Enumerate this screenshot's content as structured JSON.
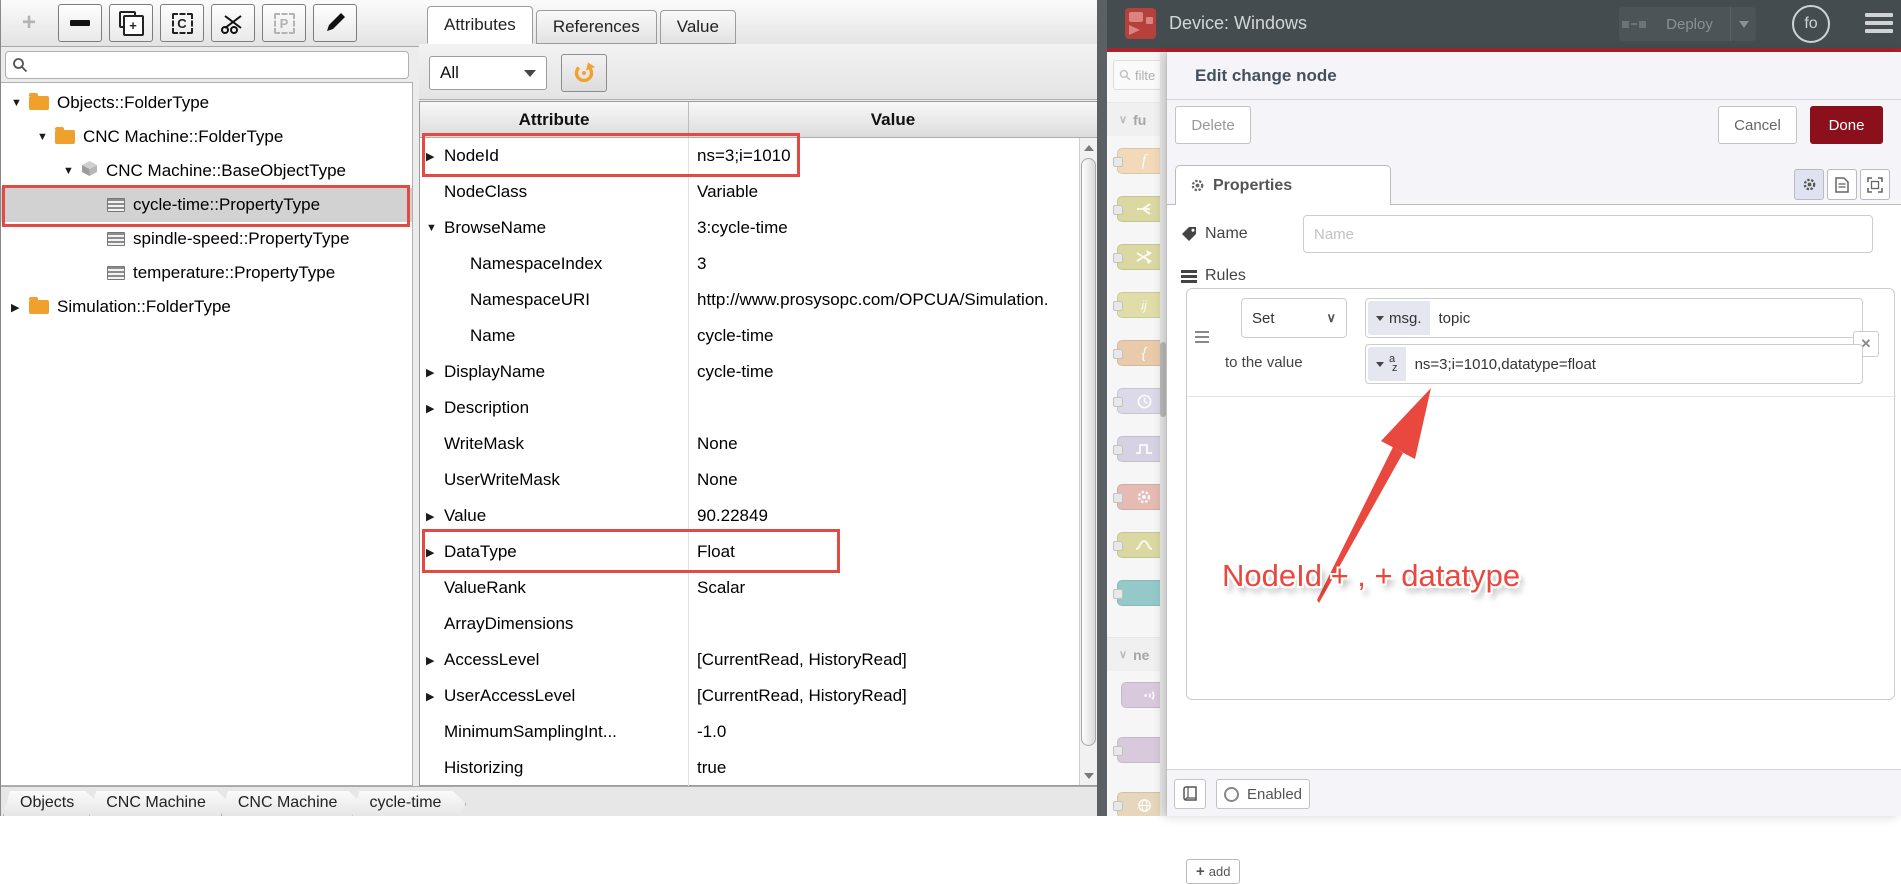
{
  "left_app": {
    "toolbar": {
      "buttons": [
        {
          "name": "add",
          "disabled": true
        },
        {
          "name": "remove",
          "disabled": false
        },
        {
          "name": "duplicate",
          "disabled": false
        },
        {
          "name": "copy",
          "disabled": false
        },
        {
          "name": "cut",
          "disabled": false
        },
        {
          "name": "paste",
          "disabled": true
        },
        {
          "name": "edit",
          "disabled": false
        }
      ]
    },
    "search": {
      "value": ""
    },
    "tree": [
      {
        "label": "Objects::FolderType",
        "level": 0,
        "expander": "open",
        "icon": "folder",
        "selected": false
      },
      {
        "label": "CNC Machine::FolderType",
        "level": 1,
        "expander": "open",
        "icon": "folder",
        "selected": false
      },
      {
        "label": "CNC Machine::BaseObjectType",
        "level": 2,
        "expander": "open",
        "icon": "object-cube",
        "selected": false
      },
      {
        "label": "cycle-time::PropertyType",
        "level": 3,
        "expander": "none",
        "icon": "property-list",
        "selected": true,
        "annotated": true
      },
      {
        "label": "spindle-speed::PropertyType",
        "level": 3,
        "expander": "none",
        "icon": "property-list",
        "selected": false
      },
      {
        "label": "temperature::PropertyType",
        "level": 3,
        "expander": "none",
        "icon": "property-list",
        "selected": false
      },
      {
        "label": "Simulation::FolderType",
        "level": 0,
        "expander": "closed",
        "icon": "folder",
        "selected": false
      }
    ],
    "tabs": [
      {
        "label": "Attributes",
        "active": true
      },
      {
        "label": "References",
        "active": false
      },
      {
        "label": "Value",
        "active": false
      }
    ],
    "filter_dropdown": "All",
    "attr_table": {
      "col_attr": "Attribute",
      "col_value": "Value",
      "rows": [
        {
          "attr": "NodeId",
          "value": "ns=3;i=1010",
          "expander": "closed",
          "annotated": true
        },
        {
          "attr": "NodeClass",
          "value": "Variable"
        },
        {
          "attr": "BrowseName",
          "value": "3:cycle-time",
          "expander": "open"
        },
        {
          "attr": "NamespaceIndex",
          "value": "3",
          "indent": 1
        },
        {
          "attr": "NamespaceURI",
          "value": "http://www.prosysopc.com/OPCUA/Simulation.",
          "indent": 1
        },
        {
          "attr": "Name",
          "value": "cycle-time",
          "indent": 1
        },
        {
          "attr": "DisplayName",
          "value": "cycle-time",
          "expander": "closed"
        },
        {
          "attr": "Description",
          "value": "",
          "expander": "closed"
        },
        {
          "attr": "WriteMask",
          "value": "None"
        },
        {
          "attr": "UserWriteMask",
          "value": "None"
        },
        {
          "attr": "Value",
          "value": "90.22849",
          "expander": "closed"
        },
        {
          "attr": "DataType",
          "value": "Float",
          "expander": "closed",
          "annotated": true
        },
        {
          "attr": "ValueRank",
          "value": "Scalar"
        },
        {
          "attr": "ArrayDimensions",
          "value": ""
        },
        {
          "attr": "AccessLevel",
          "value": "[CurrentRead, HistoryRead]",
          "expander": "closed"
        },
        {
          "attr": "UserAccessLevel",
          "value": "[CurrentRead, HistoryRead]",
          "expander": "closed"
        },
        {
          "attr": "MinimumSamplingInt...",
          "value": "-1.0"
        },
        {
          "attr": "Historizing",
          "value": "true"
        }
      ]
    },
    "breadcrumbs": [
      "Objects",
      "CNC Machine",
      "CNC Machine",
      "cycle-time"
    ]
  },
  "nodered": {
    "header": {
      "title": "Device: Windows",
      "deploy": "Deploy",
      "user": "fo"
    },
    "palette": {
      "filter": "filte",
      "section_function": "fu",
      "section_network": "ne"
    },
    "tray": {
      "title": "Edit change node",
      "delete": "Delete",
      "cancel": "Cancel",
      "done": "Done",
      "properties_tab": "Properties",
      "name_label": "Name",
      "name_placeholder": "Name",
      "rules_label": "Rules",
      "rule": {
        "action": "Set",
        "prefix": "msg.",
        "property": "topic",
        "to_label": "to the value",
        "type": "az",
        "value": "ns=3;i=1010,datatype=float"
      },
      "add": "add",
      "enabled": "Enabled"
    }
  },
  "annotation": {
    "text": "NodeId + , + datatype"
  },
  "icons": {
    "plus": "+",
    "copy_letter": "C",
    "paste_letter": "P",
    "function_letter": "f",
    "template_letters": "ij",
    "brace": "{",
    "x_label": "x"
  },
  "colors": {
    "accent_red": "#e8483e",
    "box_red": "#e14b44",
    "done_red": "#8C101C",
    "header_gray": "#454c50",
    "folder_orange": "#f0a02c",
    "refresh_orange": "#f0a22e"
  }
}
